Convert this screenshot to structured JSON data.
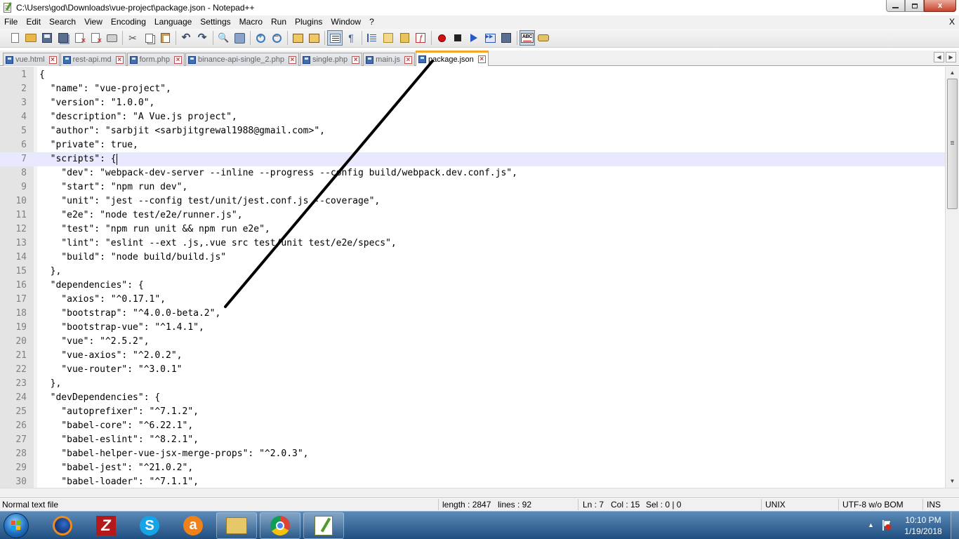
{
  "window": {
    "title": "C:\\Users\\god\\Downloads\\vue-project\\package.json - Notepad++",
    "minimize_icon": "minimize-icon",
    "maximize_icon": "restore-icon",
    "close_label": "x"
  },
  "menu": {
    "items": [
      "File",
      "Edit",
      "Search",
      "View",
      "Encoding",
      "Language",
      "Settings",
      "Macro",
      "Run",
      "Plugins",
      "Window",
      "?"
    ],
    "close_label": "X"
  },
  "toolbar": {
    "icons": [
      "new-file-icon",
      "open-file-icon",
      "save-icon",
      "save-all-icon",
      "close-file-icon",
      "close-all-icon",
      "print-icon",
      "cut-icon",
      "copy-icon",
      "paste-icon",
      "undo-icon",
      "redo-icon",
      "find-icon",
      "replace-icon",
      "zoom-in-icon",
      "zoom-out-icon",
      "sync-vertical-icon",
      "sync-horizontal-icon",
      "word-wrap-icon",
      "show-all-chars-icon",
      "indent-guide-icon",
      "user-language-icon",
      "document-map-icon",
      "function-list-icon",
      "record-macro-icon",
      "stop-recording-icon",
      "playback-macro-icon",
      "run-macro-multiple-icon",
      "save-macro-icon",
      "spell-check-icon",
      "plugin-icon"
    ],
    "spell_label": "ABC"
  },
  "tabs": [
    {
      "label": "vue.html",
      "active": false
    },
    {
      "label": "rest-api.md",
      "active": false
    },
    {
      "label": "form.php",
      "active": false
    },
    {
      "label": "binance-api-single_2.php",
      "active": false
    },
    {
      "label": "single.php",
      "active": false
    },
    {
      "label": "main.js",
      "active": false
    },
    {
      "label": "package.json",
      "active": true
    }
  ],
  "editor": {
    "current_line": 7,
    "lines": [
      {
        "no": "1",
        "text": "{"
      },
      {
        "no": "2",
        "text": "  \"name\": \"vue-project\","
      },
      {
        "no": "3",
        "text": "  \"version\": \"1.0.0\","
      },
      {
        "no": "4",
        "text": "  \"description\": \"A Vue.js project\","
      },
      {
        "no": "5",
        "text": "  \"author\": \"sarbjit <sarbjitgrewal1988@gmail.com>\","
      },
      {
        "no": "6",
        "text": "  \"private\": true,"
      },
      {
        "no": "7",
        "text": "  \"scripts\": {"
      },
      {
        "no": "8",
        "text": "    \"dev\": \"webpack-dev-server --inline --progress --config build/webpack.dev.conf.js\","
      },
      {
        "no": "9",
        "text": "    \"start\": \"npm run dev\","
      },
      {
        "no": "10",
        "text": "    \"unit\": \"jest --config test/unit/jest.conf.js --coverage\","
      },
      {
        "no": "11",
        "text": "    \"e2e\": \"node test/e2e/runner.js\","
      },
      {
        "no": "12",
        "text": "    \"test\": \"npm run unit && npm run e2e\","
      },
      {
        "no": "13",
        "text": "    \"lint\": \"eslint --ext .js,.vue src test/unit test/e2e/specs\","
      },
      {
        "no": "14",
        "text": "    \"build\": \"node build/build.js\""
      },
      {
        "no": "15",
        "text": "  },"
      },
      {
        "no": "16",
        "text": "  \"dependencies\": {"
      },
      {
        "no": "17",
        "text": "    \"axios\": \"^0.17.1\","
      },
      {
        "no": "18",
        "text": "    \"bootstrap\": \"^4.0.0-beta.2\","
      },
      {
        "no": "19",
        "text": "    \"bootstrap-vue\": \"^1.4.1\","
      },
      {
        "no": "20",
        "text": "    \"vue\": \"^2.5.2\","
      },
      {
        "no": "21",
        "text": "    \"vue-axios\": \"^2.0.2\","
      },
      {
        "no": "22",
        "text": "    \"vue-router\": \"^3.0.1\""
      },
      {
        "no": "23",
        "text": "  },"
      },
      {
        "no": "24",
        "text": "  \"devDependencies\": {"
      },
      {
        "no": "25",
        "text": "    \"autoprefixer\": \"^7.1.2\","
      },
      {
        "no": "26",
        "text": "    \"babel-core\": \"^6.22.1\","
      },
      {
        "no": "27",
        "text": "    \"babel-eslint\": \"^8.2.1\","
      },
      {
        "no": "28",
        "text": "    \"babel-helper-vue-jsx-merge-props\": \"^2.0.3\","
      },
      {
        "no": "29",
        "text": "    \"babel-jest\": \"^21.0.2\","
      },
      {
        "no": "30",
        "text": "    \"babel-loader\": \"^7.1.1\","
      }
    ]
  },
  "status": {
    "file_type": "Normal text file",
    "length": "length : 2847",
    "lines": "lines : 92",
    "ln": "Ln : 7",
    "col": "Col : 15",
    "sel": "Sel : 0 | 0",
    "eol": "UNIX",
    "encoding": "UTF-8 w/o BOM",
    "mode": "INS"
  },
  "taskbar": {
    "apps": [
      "firefox-icon",
      "filezilla-icon",
      "skype-icon",
      "avast-icon",
      "file-explorer-icon",
      "chrome-icon",
      "notepadpp-icon"
    ],
    "filezilla_glyph": "Z",
    "skype_glyph": "S",
    "avast_glyph": "a",
    "clock_time": "10:10 PM",
    "clock_date": "1/19/2018"
  },
  "colors": {
    "active_tab_accent": "#f5a623",
    "current_line_bg": "#e8e8ff",
    "gutter_bg": "#e4e4e4",
    "brace_highlight": "#ff0000",
    "annotation_stroke": "#000000"
  }
}
